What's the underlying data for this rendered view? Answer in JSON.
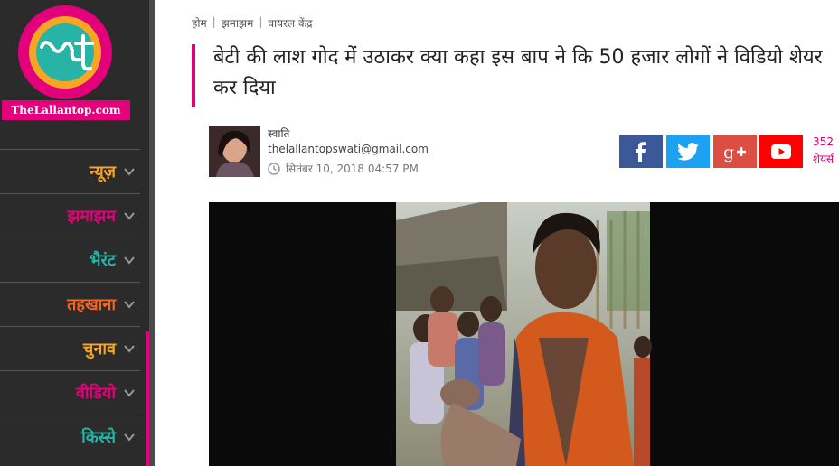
{
  "logo": {
    "text": "TheLallantop.com"
  },
  "sidebar": {
    "items": [
      {
        "label": "न्यूज़",
        "color": "#f6a623"
      },
      {
        "label": "झमाझम",
        "color": "#e3007a"
      },
      {
        "label": "भैरंट",
        "color": "#27b3a6"
      },
      {
        "label": "तहखाना",
        "color": "#f26522"
      },
      {
        "label": "चुनाव",
        "color": "#f6a623"
      },
      {
        "label": "वीडियो",
        "color": "#e3007a"
      },
      {
        "label": "किस्से",
        "color": "#27b3a6"
      }
    ]
  },
  "breadcrumb": {
    "items": [
      "होम",
      "झमाझम",
      "वायरल केंद्र"
    ],
    "separator": "|"
  },
  "article": {
    "title": "बेटी की लाश गोद में उठाकर क्या कहा इस बाप ने कि 50 हजार लोगों ने विडियो शेयर कर दिया",
    "author": "स्वाति",
    "email": "thelallantopswati@gmail.com",
    "date": "सितंबर 10, 2018 04:57 PM"
  },
  "share": {
    "count": "352",
    "label": "शेयर्स",
    "buttons": [
      "facebook-icon",
      "twitter-icon",
      "google-plus-icon",
      "youtube-icon"
    ]
  },
  "colors": {
    "accent": "#e3007a",
    "sidebar_bg": "#2b2b2b"
  }
}
